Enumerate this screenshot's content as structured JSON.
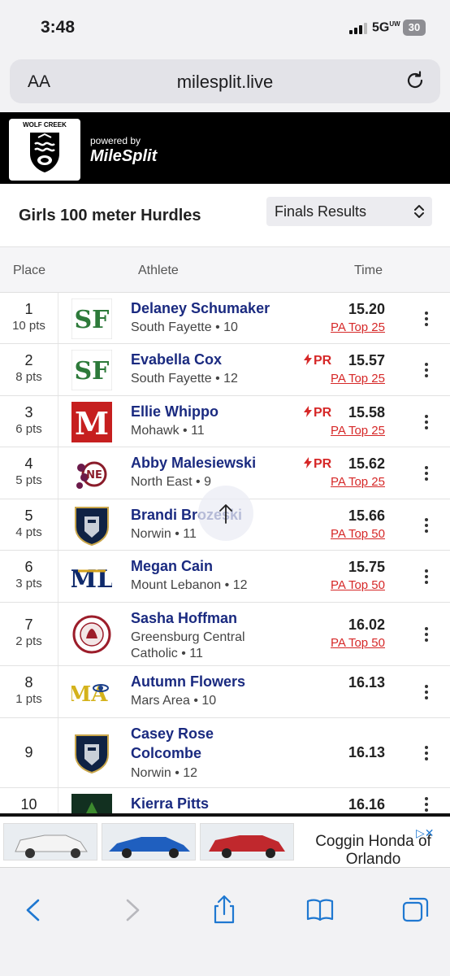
{
  "status": {
    "time": "3:48",
    "network": "5G",
    "network_sup": "UW",
    "battery": "30"
  },
  "browser": {
    "text_size": "AA",
    "url": "milesplit.live"
  },
  "header": {
    "school": "WOLF CREEK",
    "powered_by": "powered by",
    "brand": "MileSplit"
  },
  "event": {
    "title": "Girls 100 meter Hurdles",
    "selected": "Finals Results"
  },
  "table": {
    "columns": {
      "place": "Place",
      "athlete": "Athlete",
      "time": "Time"
    },
    "rows": [
      {
        "place": "1",
        "pts": "10 pts",
        "name": "Delaney Schumaker",
        "team": "South Fayette • 10",
        "pr": "",
        "time": "15.20",
        "rank": "PA Top 25",
        "logo": "sf-logo"
      },
      {
        "place": "2",
        "pts": "8 pts",
        "name": "Evabella Cox",
        "team": "South Fayette • 12",
        "pr": "PR",
        "time": "15.57",
        "rank": "PA Top 25",
        "logo": "sf-logo"
      },
      {
        "place": "3",
        "pts": "6 pts",
        "name": "Ellie Whippo",
        "team": "Mohawk • 11",
        "pr": "PR",
        "time": "15.58",
        "rank": "PA Top 25",
        "logo": "mohawk-logo"
      },
      {
        "place": "4",
        "pts": "5 pts",
        "name": "Abby Malesiewski",
        "team": "North East • 9",
        "pr": "PR",
        "time": "15.62",
        "rank": "PA Top 25",
        "logo": "north-east-logo"
      },
      {
        "place": "5",
        "pts": "4 pts",
        "name": "Brandi Brozeski",
        "team": "Norwin • 11",
        "pr": "",
        "time": "15.66",
        "rank": "PA Top 50",
        "logo": "norwin-logo"
      },
      {
        "place": "6",
        "pts": "3 pts",
        "name": "Megan Cain",
        "team": "Mount Lebanon • 12",
        "pr": "",
        "time": "15.75",
        "rank": "PA Top 50",
        "logo": "mt-lebanon-logo"
      },
      {
        "place": "7",
        "pts": "2 pts",
        "name": "Sasha Hoffman",
        "team": "Greensburg Central Catholic • 11",
        "pr": "",
        "time": "16.02",
        "rank": "PA Top 50",
        "logo": "gcc-logo"
      },
      {
        "place": "8",
        "pts": "1 pts",
        "name": "Autumn Flowers",
        "team": "Mars Area • 10",
        "pr": "",
        "time": "16.13",
        "rank": "",
        "logo": "mars-logo"
      },
      {
        "place": "9",
        "pts": "",
        "name": "Casey Rose Colcombe",
        "team": "Norwin • 12",
        "pr": "",
        "time": "16.13",
        "rank": "",
        "logo": "norwin-logo"
      },
      {
        "place": "10",
        "pts": "",
        "name": "Kierra Pitts",
        "team": "",
        "pr": "",
        "time": "16.16",
        "rank": "",
        "logo": "team-logo"
      }
    ]
  },
  "ad": {
    "text": "Coggin Honda of Orlando",
    "ad_choices": "▷✕"
  },
  "icons": [
    "back-icon",
    "forward-icon",
    "share-icon",
    "bookmarks-icon",
    "tabs-icon",
    "reload-icon",
    "kebab-icon",
    "arrow-up-icon"
  ],
  "colors": {
    "accent": "#d62828",
    "athlete_name": "#1a2a80",
    "header": "#000000"
  }
}
